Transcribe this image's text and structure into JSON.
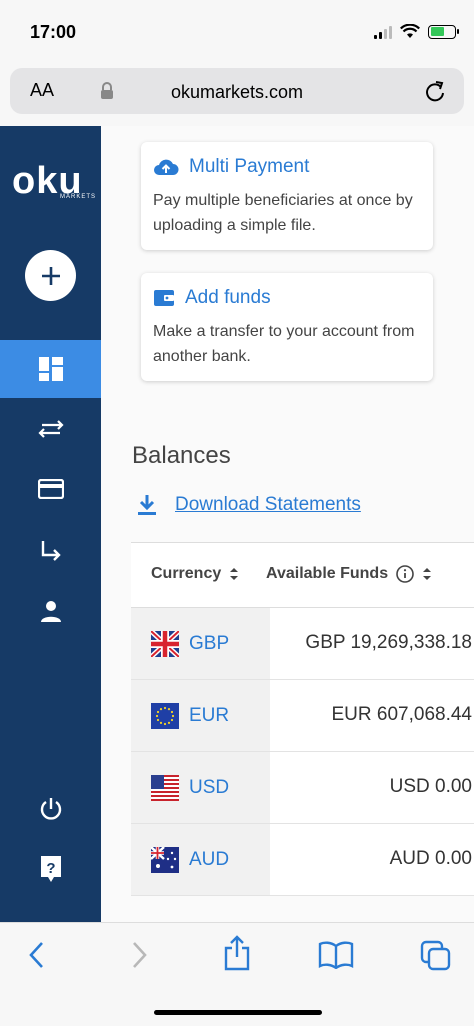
{
  "status": {
    "time": "17:00"
  },
  "browser": {
    "text_size": "AA",
    "url": "okumarkets.com"
  },
  "brand": {
    "logo": "oku",
    "logo_sub": "MARKETS"
  },
  "sidebar": {
    "items": [
      {
        "name": "add",
        "icon": "plus-icon"
      },
      {
        "name": "dashboard",
        "icon": "dashboard-icon",
        "active": true
      },
      {
        "name": "transfers",
        "icon": "swap-arrows-icon"
      },
      {
        "name": "cards",
        "icon": "credit-card-icon"
      },
      {
        "name": "payments",
        "icon": "subdirectory-arrow-icon"
      },
      {
        "name": "profile",
        "icon": "person-icon"
      },
      {
        "name": "logout",
        "icon": "power-icon"
      },
      {
        "name": "help",
        "icon": "help-icon"
      }
    ]
  },
  "cards": [
    {
      "title": "Multi Payment",
      "icon": "cloud-upload-icon",
      "description": "Pay multiple beneficiaries at once by uploading a simple file."
    },
    {
      "title": "Add funds",
      "icon": "wallet-icon",
      "description": "Make a transfer to your account from another bank."
    }
  ],
  "balances": {
    "title": "Balances",
    "download_label": "Download Statements",
    "columns": [
      "Currency",
      "Available Funds"
    ],
    "rows": [
      {
        "currency": "GBP",
        "flag": "uk-flag",
        "amount": "GBP 19,269,338.18"
      },
      {
        "currency": "EUR",
        "flag": "eu-flag",
        "amount": "EUR 607,068.44"
      },
      {
        "currency": "USD",
        "flag": "us-flag",
        "amount": "USD 0.00"
      },
      {
        "currency": "AUD",
        "flag": "au-flag",
        "amount": "AUD 0.00"
      }
    ]
  },
  "colors": {
    "sidebar": "#163a66",
    "active": "#3c8ce4",
    "link": "#2a7bd3"
  }
}
